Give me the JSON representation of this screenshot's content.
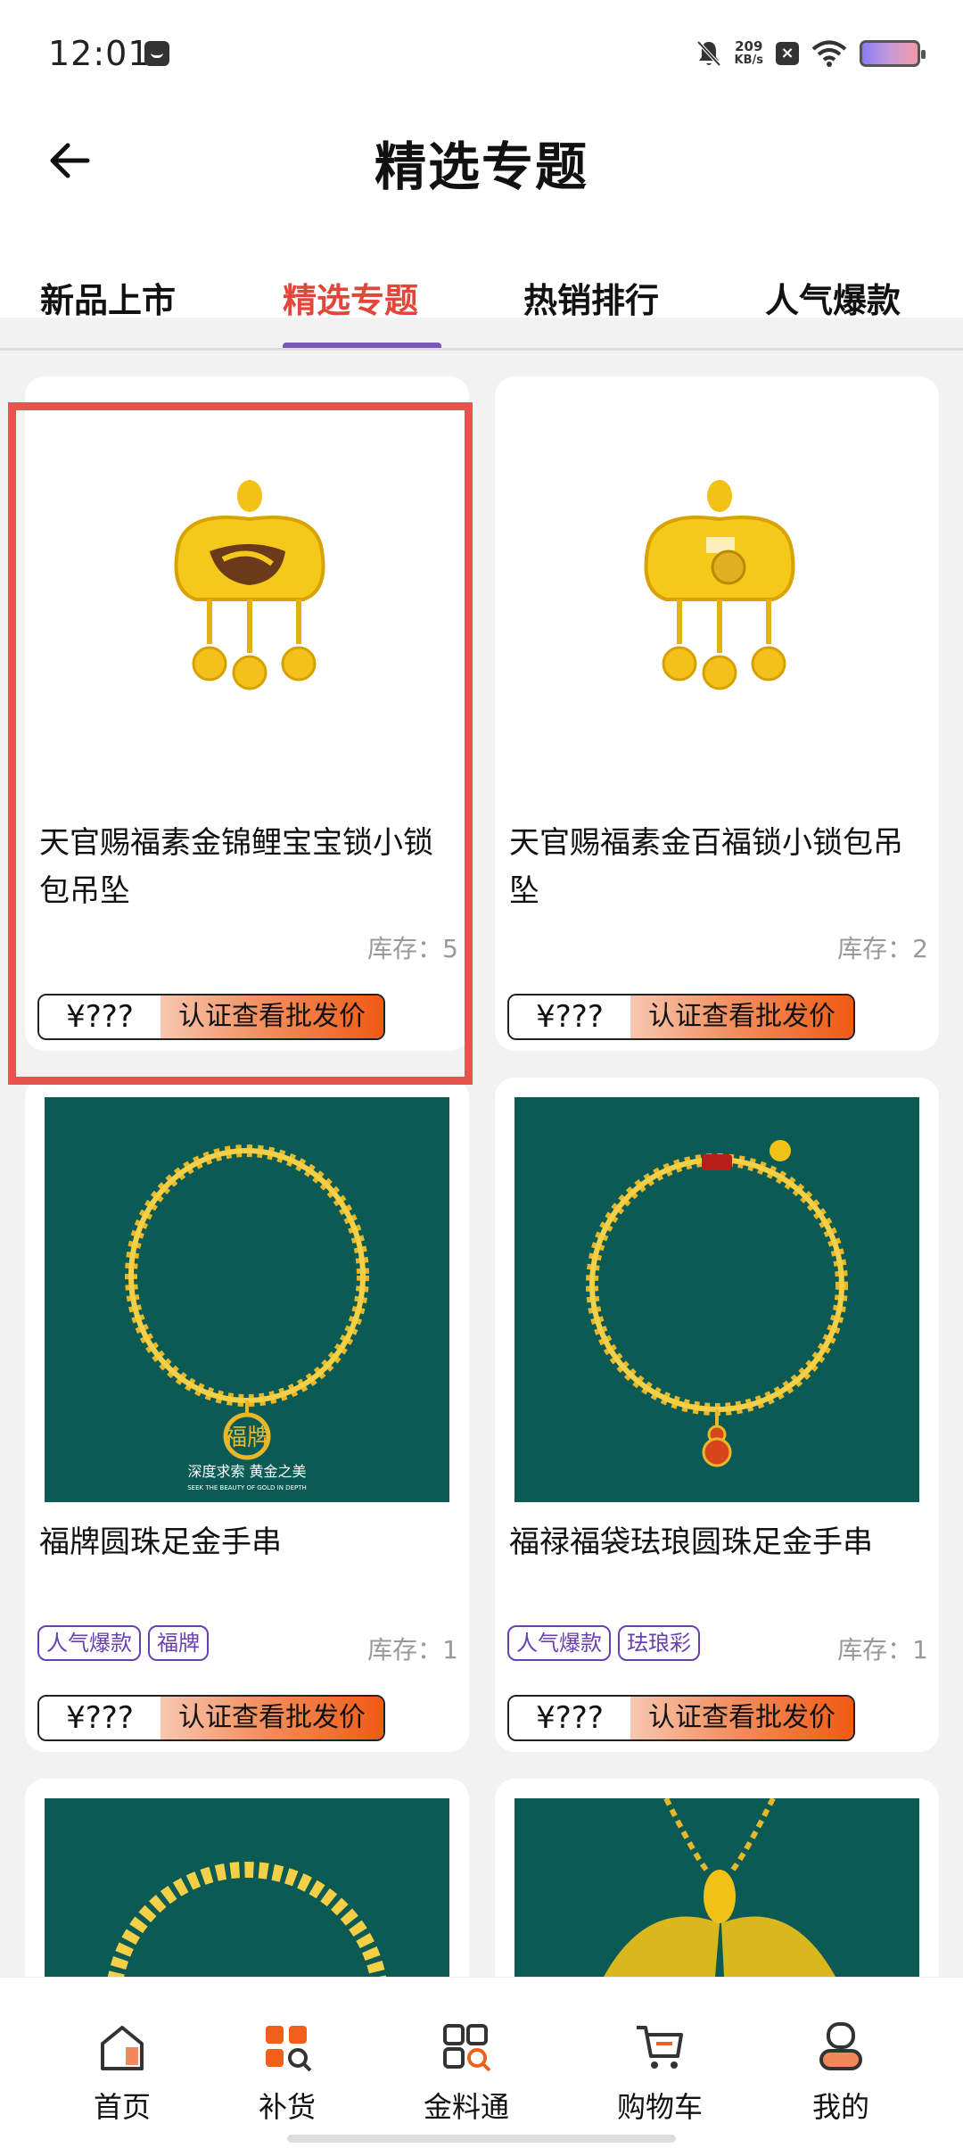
{
  "status_bar": {
    "time": "12:01",
    "net_speed_value": "209",
    "net_speed_unit": "KB/s"
  },
  "header": {
    "title": "精选专题",
    "back_icon": "arrow-left-icon"
  },
  "tabs": [
    {
      "label": "新品上市",
      "active": false
    },
    {
      "label": "精选专题",
      "active": true
    },
    {
      "label": "热销排行",
      "active": false
    },
    {
      "label": "人气爆款",
      "active": false
    }
  ],
  "colors": {
    "accent_tab": "#e2463a",
    "tab_underline": "#7a56b8",
    "highlight_border": "#e8534e",
    "tag_color": "#6a3fb0",
    "product_bg_dark": "#0b5a54"
  },
  "products": [
    {
      "title": "天官赐福素金锦鲤宝宝锁小锁包吊坠",
      "stock_label": "库存：",
      "stock": "5",
      "price": "¥???",
      "cta": "认证查看批发价",
      "tags": []
    },
    {
      "title": "天官赐福素金百福锁小锁包吊坠",
      "stock_label": "库存：",
      "stock": "2",
      "price": "¥???",
      "cta": "认证查看批发价",
      "tags": []
    },
    {
      "title": "福牌圆珠足金手串",
      "stock_label": "库存：",
      "stock": "1",
      "price": "¥???",
      "cta": "认证查看批发价",
      "tags": [
        "人气爆款",
        "福牌"
      ],
      "image_caption": "深度求索 黄金之美",
      "image_caption_sub": "SEEK THE BEAUTY OF GOLD IN DEPTH"
    },
    {
      "title": "福禄福袋珐琅圆珠足金手串",
      "stock_label": "库存：",
      "stock": "1",
      "price": "¥???",
      "cta": "认证查看批发价",
      "tags": [
        "人气爆款",
        "珐琅彩"
      ]
    }
  ],
  "bottom_nav": [
    {
      "label": "首页",
      "icon": "home-icon"
    },
    {
      "label": "补货",
      "icon": "restock-grid-icon",
      "active": true
    },
    {
      "label": "金料通",
      "icon": "gold-material-icon"
    },
    {
      "label": "购物车",
      "icon": "cart-icon"
    },
    {
      "label": "我的",
      "icon": "profile-icon"
    }
  ]
}
